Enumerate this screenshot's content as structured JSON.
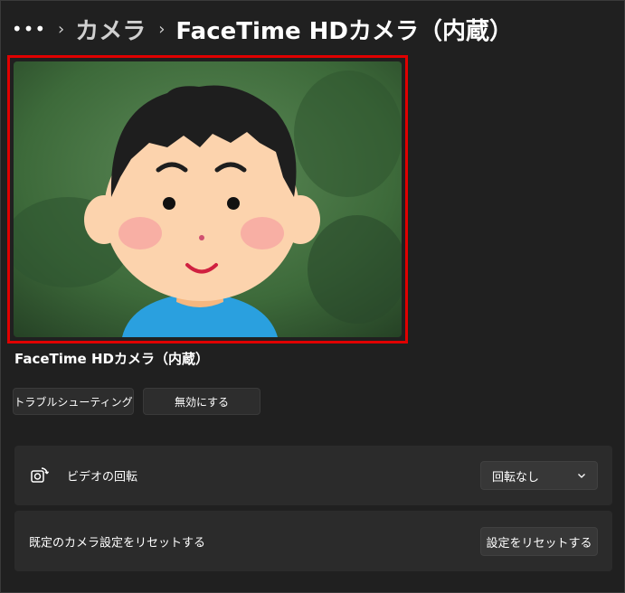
{
  "breadcrumb": {
    "more_icon": "ellipsis-icon",
    "items": [
      "カメラ",
      "FaceTime HDカメラ（内蔵）"
    ]
  },
  "preview": {
    "highlight_color": "#e00000",
    "image": "camera preview of cartoon boy illustration"
  },
  "camera": {
    "name": "FaceTime HDカメラ（内蔵）"
  },
  "actions": {
    "troubleshoot_label": "トラブルシューティング",
    "disable_label": "無効にする"
  },
  "settings": {
    "rotation": {
      "icon": "rotate-camera-icon",
      "label": "ビデオの回転",
      "value": "回転なし"
    },
    "reset": {
      "label": "既定のカメラ設定をリセットする",
      "button_label": "設定をリセットする"
    }
  }
}
